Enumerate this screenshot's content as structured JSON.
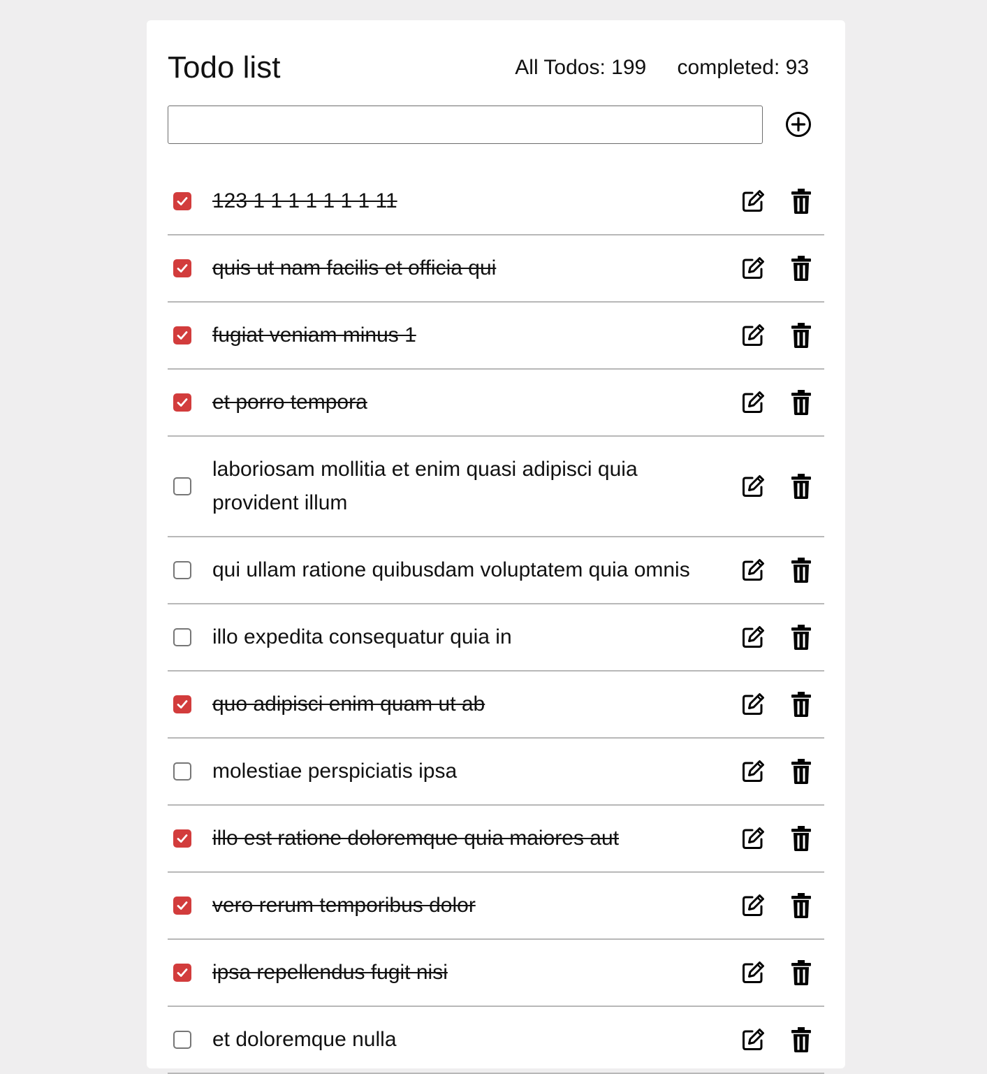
{
  "header": {
    "title": "Todo list",
    "all_label": "All Todos: 199",
    "completed_label": "completed: 93"
  },
  "add_form": {
    "input_value": "",
    "add_icon": "plus-circle-icon"
  },
  "icons": {
    "edit": "pencil-square-icon",
    "delete": "trash-icon",
    "check": "checkmark-icon"
  },
  "colors": {
    "checked": "#d23c3c",
    "background": "#efeeef",
    "divider": "#b8b8b8"
  },
  "todos": [
    {
      "text": "123 1 1 1 1 1 1 1 11",
      "completed": true
    },
    {
      "text": "quis ut nam facilis et officia qui",
      "completed": true
    },
    {
      "text": "fugiat veniam minus 1",
      "completed": true
    },
    {
      "text": "et porro tempora",
      "completed": true
    },
    {
      "text": "laboriosam mollitia et enim quasi adipisci quia provident illum",
      "completed": false
    },
    {
      "text": "qui ullam ratione quibusdam voluptatem quia omnis",
      "completed": false
    },
    {
      "text": "illo expedita consequatur quia in",
      "completed": false
    },
    {
      "text": "quo adipisci enim quam ut ab",
      "completed": true
    },
    {
      "text": "molestiae perspiciatis ipsa",
      "completed": false
    },
    {
      "text": "illo est ratione doloremque quia maiores aut",
      "completed": true
    },
    {
      "text": "vero rerum temporibus dolor",
      "completed": true
    },
    {
      "text": "ipsa repellendus fugit nisi",
      "completed": true
    },
    {
      "text": "et doloremque nulla",
      "completed": false
    }
  ]
}
